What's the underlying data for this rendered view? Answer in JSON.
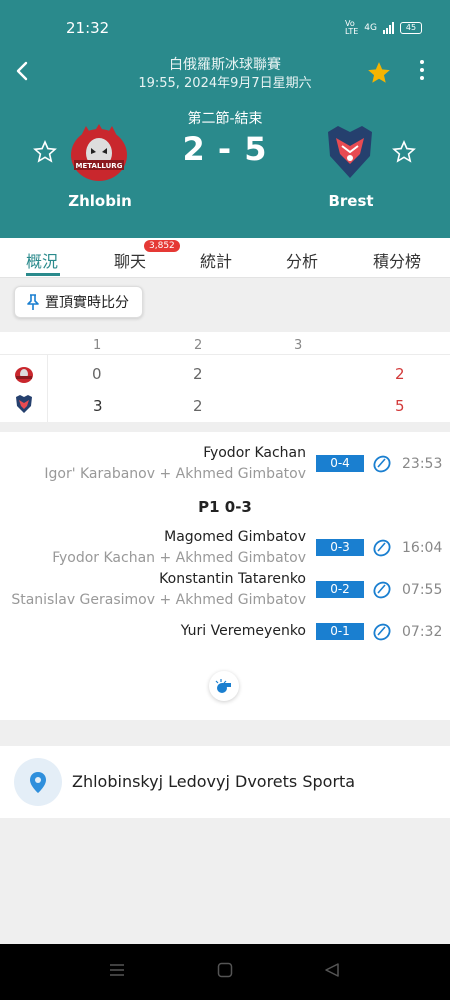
{
  "status": {
    "time": "21:32",
    "network": "4G",
    "battery": "45"
  },
  "header": {
    "league": "白俄羅斯冰球聯賽",
    "datetime": "19:55, 2024年9月7日星期六",
    "period_status": "第二節-結束",
    "score": "2 - 5",
    "home_team": "Zhlobin",
    "away_team": "Brest",
    "colors": {
      "header_bg": "#2a8a8c",
      "favorite_star": "#f5b400"
    }
  },
  "tabs": [
    {
      "label": "概況",
      "active": true
    },
    {
      "label": "聊天",
      "badge": "3,852"
    },
    {
      "label": "統計"
    },
    {
      "label": "分析"
    },
    {
      "label": "積分榜"
    }
  ],
  "pin_button": {
    "label": "置頂實時比分"
  },
  "score_table": {
    "periods": [
      "1",
      "2",
      "3"
    ],
    "home": {
      "p1": "0",
      "p2": "2",
      "total": "2"
    },
    "away": {
      "p1": "3",
      "p2": "2",
      "total": "5"
    }
  },
  "events": [
    {
      "scorer": "Fyodor Kachan",
      "assists": "Igor' Karabanov + Akhmed Gimbatov",
      "score": "0-4",
      "time": "23:53"
    },
    {
      "period_label": "P1 0-3"
    },
    {
      "scorer": "Magomed Gimbatov",
      "assists": "Fyodor Kachan + Akhmed Gimbatov",
      "score": "0-3",
      "time": "16:04"
    },
    {
      "scorer": "Konstantin Tatarenko",
      "assists": "Stanislav Gerasimov + Akhmed Gimbatov",
      "score": "0-2",
      "time": "07:55"
    },
    {
      "scorer": "Yuri Veremeyenko",
      "score": "0-1",
      "time": "07:32"
    }
  ],
  "venue": {
    "name": "Zhlobinskyj Ledovyj Dvorets Sporta",
    "icon": "location-pin-icon"
  }
}
